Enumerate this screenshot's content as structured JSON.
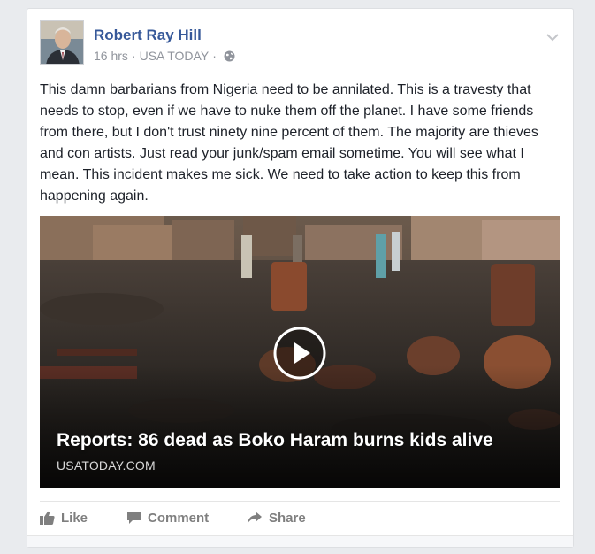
{
  "post": {
    "author": "Robert Ray Hill",
    "time": "16 hrs",
    "source_app": "USA TODAY",
    "separator": "·",
    "privacy_icon": "globe-icon",
    "options_icon": "chevron-down-icon",
    "text": "This damn barbarians from Nigeria need to be annilated. This is a travesty that needs to stop, even if we have to nuke them off the planet. I have some friends from there, but I don't trust ninety nine percent of them. The majority are thieves and con artists. Just read your junk/spam email sometime. You will see what I mean. This incident makes me sick. We need to take action to keep this from happening again."
  },
  "attachment": {
    "headline": "Reports: 86 dead as Boko Haram burns kids alive",
    "source": "USATODAY.COM",
    "play_icon": "play-icon"
  },
  "actions": {
    "like": "Like",
    "comment": "Comment",
    "share": "Share"
  },
  "colors": {
    "author": "#365899",
    "meta": "#90949c",
    "text": "#1d2129",
    "action": "#7f7f7f"
  }
}
